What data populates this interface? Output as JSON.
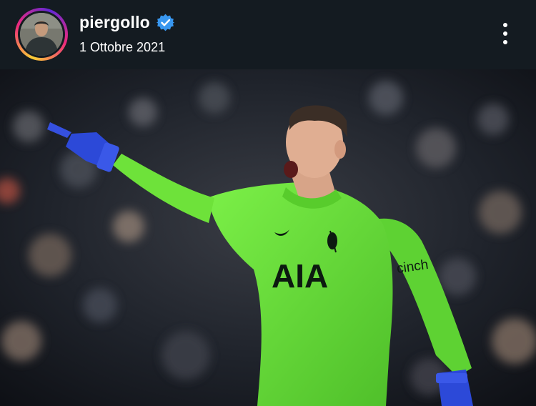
{
  "post": {
    "username": "piergollo",
    "verified": true,
    "date": "1 Ottobre 2021",
    "more_icon": "more-vertical-icon"
  },
  "photo": {
    "shirt_text": "AIA",
    "sleeve_text": "cinch"
  },
  "colors": {
    "header_bg": "#141b21",
    "verified_blue": "#3897f0",
    "kit_green": "#6ee23a",
    "glove_blue": "#2c49d8"
  }
}
